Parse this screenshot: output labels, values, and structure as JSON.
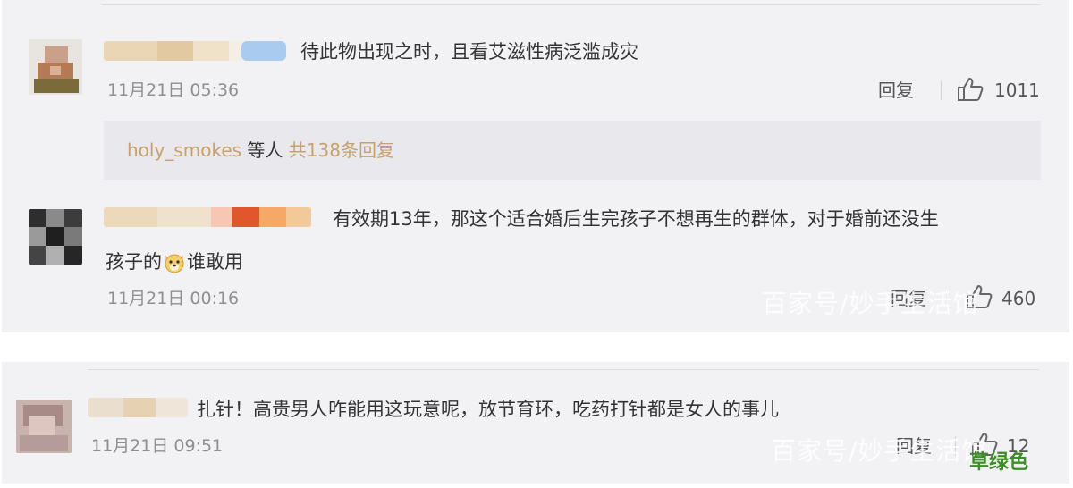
{
  "comments": [
    {
      "text": "待此物出现之时，且看艾滋性病泛滥成灾",
      "time": "11月21日 05:36",
      "reply_label": "回复",
      "likes": "1011"
    },
    {
      "text_line1": "有效期13年，那这个适合婚后生完孩子不想再生的群体，对于婚前还没生",
      "text_line2_before": "孩子的",
      "emoji_icon": "dog-face-emoji",
      "text_line2_after": "谁敢用",
      "time": "11月21日 00:16",
      "reply_label": "回复",
      "likes": "460"
    },
    {
      "text": "扎针！高贵男人咋能用这玩意呢，放节育环，吃药打针都是女人的事儿",
      "time": "11月21日 09:51",
      "reply_label": "回复",
      "likes": "12"
    }
  ],
  "subreplies": {
    "username": "holy_smokes",
    "middle": "等人",
    "count_link": "共138条回复"
  },
  "watermark": "百家号/妙手生活馆",
  "corner_label": "草绿色",
  "icons": {
    "like": "thumbs-up-icon",
    "emoji": "dog-face-emoji"
  },
  "colors": {
    "link": "#c7a16a",
    "time": "#8f8f8f",
    "card_bg": "#f2f2f5",
    "corner": "#3a8f25"
  }
}
